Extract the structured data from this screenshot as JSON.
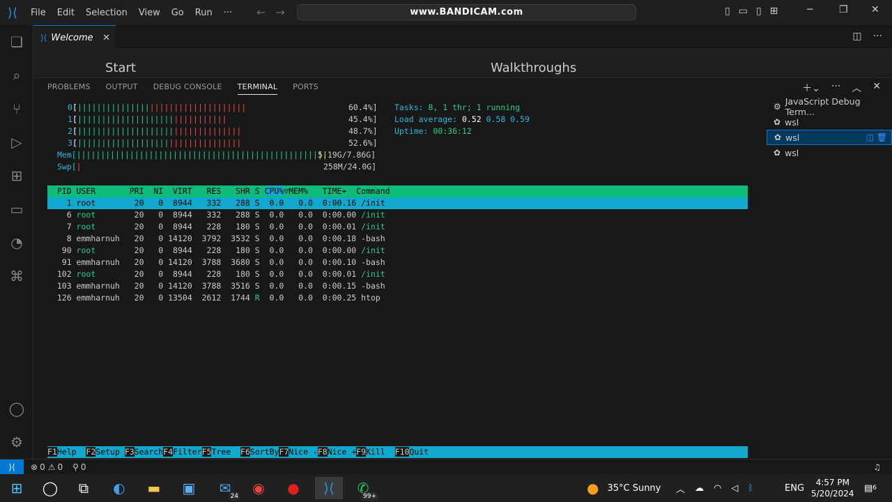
{
  "titlebar": {
    "menu": [
      "File",
      "Edit",
      "Selection",
      "View",
      "Go",
      "Run",
      "···"
    ],
    "search_text": "www.BANDICAM.com"
  },
  "tab": {
    "label": "Welcome"
  },
  "welcome": {
    "start": "Start",
    "walkthroughs": "Walkthroughs"
  },
  "panel": {
    "tabs": [
      "PROBLEMS",
      "OUTPUT",
      "DEBUG CONSOLE",
      "TERMINAL",
      "PORTS"
    ],
    "active_tab": "TERMINAL"
  },
  "htop": {
    "cpus": [
      {
        "id": "0",
        "green": "|||||||||||||||",
        "red": "||||||||||||||||||||",
        "pct": "60.4%]"
      },
      {
        "id": "1",
        "green": "||||||||||||||||||||",
        "red": "|||||||||||",
        "pct": "45.4%]"
      },
      {
        "id": "2",
        "green": "||||||||||||||||||||",
        "red": "||||||||||||||",
        "pct": "48.7%]"
      },
      {
        "id": "3",
        "green": "|||||||||||||||||||",
        "red": "|||||||||||||||",
        "pct": "52.6%]"
      }
    ],
    "mem_label": "Mem[",
    "mem_bar": "||||||||||||||||||||||||||||||||||||||||||||||||||",
    "mem_val": "5.19G/7.86G]",
    "swp_label": "Swp[",
    "swp_bar": "|",
    "swp_val": "258M/24.0G]",
    "tasks_label": "Tasks: ",
    "tasks_val": "8, 1 thr; 1 running",
    "load_label": "Load average: ",
    "load1": "0.52",
    "load_rest": " 0.58 0.59",
    "uptime_label": "Uptime: ",
    "uptime_val": "00:36:12",
    "header_a": "  PID USER       PRI  NI  VIRT   RES   SHR S ",
    "header_cpu": "CPU%",
    "header_b": "▽MEM%   TIME+  Command",
    "rows": [
      {
        "pid": "1",
        "user": "root",
        "pri": "20",
        "ni": "0",
        "virt": "8944",
        "res": "332",
        "shr": "288",
        "s": "S",
        "cpu": "0.0",
        "mem": "0.0",
        "time": "0:00.16",
        "cmd": "/init"
      },
      {
        "pid": "6",
        "user": "root",
        "pri": "20",
        "ni": "0",
        "virt": "8944",
        "res": "332",
        "shr": "288",
        "s": "S",
        "cpu": "0.0",
        "mem": "0.0",
        "time": "0:00.00",
        "cmd": "/init"
      },
      {
        "pid": "7",
        "user": "root",
        "pri": "20",
        "ni": "0",
        "virt": "8944",
        "res": "228",
        "shr": "180",
        "s": "S",
        "cpu": "0.0",
        "mem": "0.0",
        "time": "0:00.01",
        "cmd": "/init"
      },
      {
        "pid": "8",
        "user": "emmharnuh",
        "pri": "20",
        "ni": "0",
        "virt": "14120",
        "res": "3792",
        "shr": "3532",
        "s": "S",
        "cpu": "0.0",
        "mem": "0.0",
        "time": "0:00.18",
        "cmd": "-bash"
      },
      {
        "pid": "90",
        "user": "root",
        "pri": "20",
        "ni": "0",
        "virt": "8944",
        "res": "228",
        "shr": "180",
        "s": "S",
        "cpu": "0.0",
        "mem": "0.0",
        "time": "0:00.00",
        "cmd": "/init"
      },
      {
        "pid": "91",
        "user": "emmharnuh",
        "pri": "20",
        "ni": "0",
        "virt": "14120",
        "res": "3788",
        "shr": "3680",
        "s": "S",
        "cpu": "0.0",
        "mem": "0.0",
        "time": "0:00.10",
        "cmd": "-bash"
      },
      {
        "pid": "102",
        "user": "root",
        "pri": "20",
        "ni": "0",
        "virt": "8944",
        "res": "228",
        "shr": "180",
        "s": "S",
        "cpu": "0.0",
        "mem": "0.0",
        "time": "0:00.01",
        "cmd": "/init"
      },
      {
        "pid": "103",
        "user": "emmharnuh",
        "pri": "20",
        "ni": "0",
        "virt": "14120",
        "res": "3788",
        "shr": "3516",
        "s": "S",
        "cpu": "0.0",
        "mem": "0.0",
        "time": "0:00.15",
        "cmd": "-bash"
      },
      {
        "pid": "126",
        "user": "emmharnuh",
        "pri": "20",
        "ni": "0",
        "virt": "13504",
        "res": "2612",
        "shr": "1744",
        "s": "R",
        "cpu": "0.0",
        "mem": "0.0",
        "time": "0:00.25",
        "cmd": "htop"
      }
    ],
    "fkeys": [
      {
        "k": "F1",
        "l": "Help  "
      },
      {
        "k": "F2",
        "l": "Setup "
      },
      {
        "k": "F3",
        "l": "Search"
      },
      {
        "k": "F4",
        "l": "Filter"
      },
      {
        "k": "F5",
        "l": "Tree  "
      },
      {
        "k": "F6",
        "l": "SortBy"
      },
      {
        "k": "F7",
        "l": "Nice -"
      },
      {
        "k": "F8",
        "l": "Nice +"
      },
      {
        "k": "F9",
        "l": "Kill  "
      },
      {
        "k": "F10",
        "l": "Quit  "
      }
    ]
  },
  "terminals": [
    {
      "label": "JavaScript Debug Term...",
      "icon": "bug-icon"
    },
    {
      "label": "wsl",
      "icon": "linux-icon"
    },
    {
      "label": "wsl",
      "icon": "linux-icon"
    },
    {
      "label": "wsl",
      "icon": "linux-icon"
    }
  ],
  "statusbar": {
    "errors": "0",
    "warnings": "0",
    "ports": "0"
  },
  "taskbar": {
    "mail_badge": "24",
    "whatsapp_badge": "99+",
    "weather": "35°C  Sunny",
    "lang": "ENG",
    "time": "4:57 PM",
    "date": "5/20/2024",
    "notif": "6"
  },
  "colors": {
    "accent": "#0078d4",
    "htop_green": "#0dbc79",
    "htop_cyan": "#11a8cd"
  }
}
